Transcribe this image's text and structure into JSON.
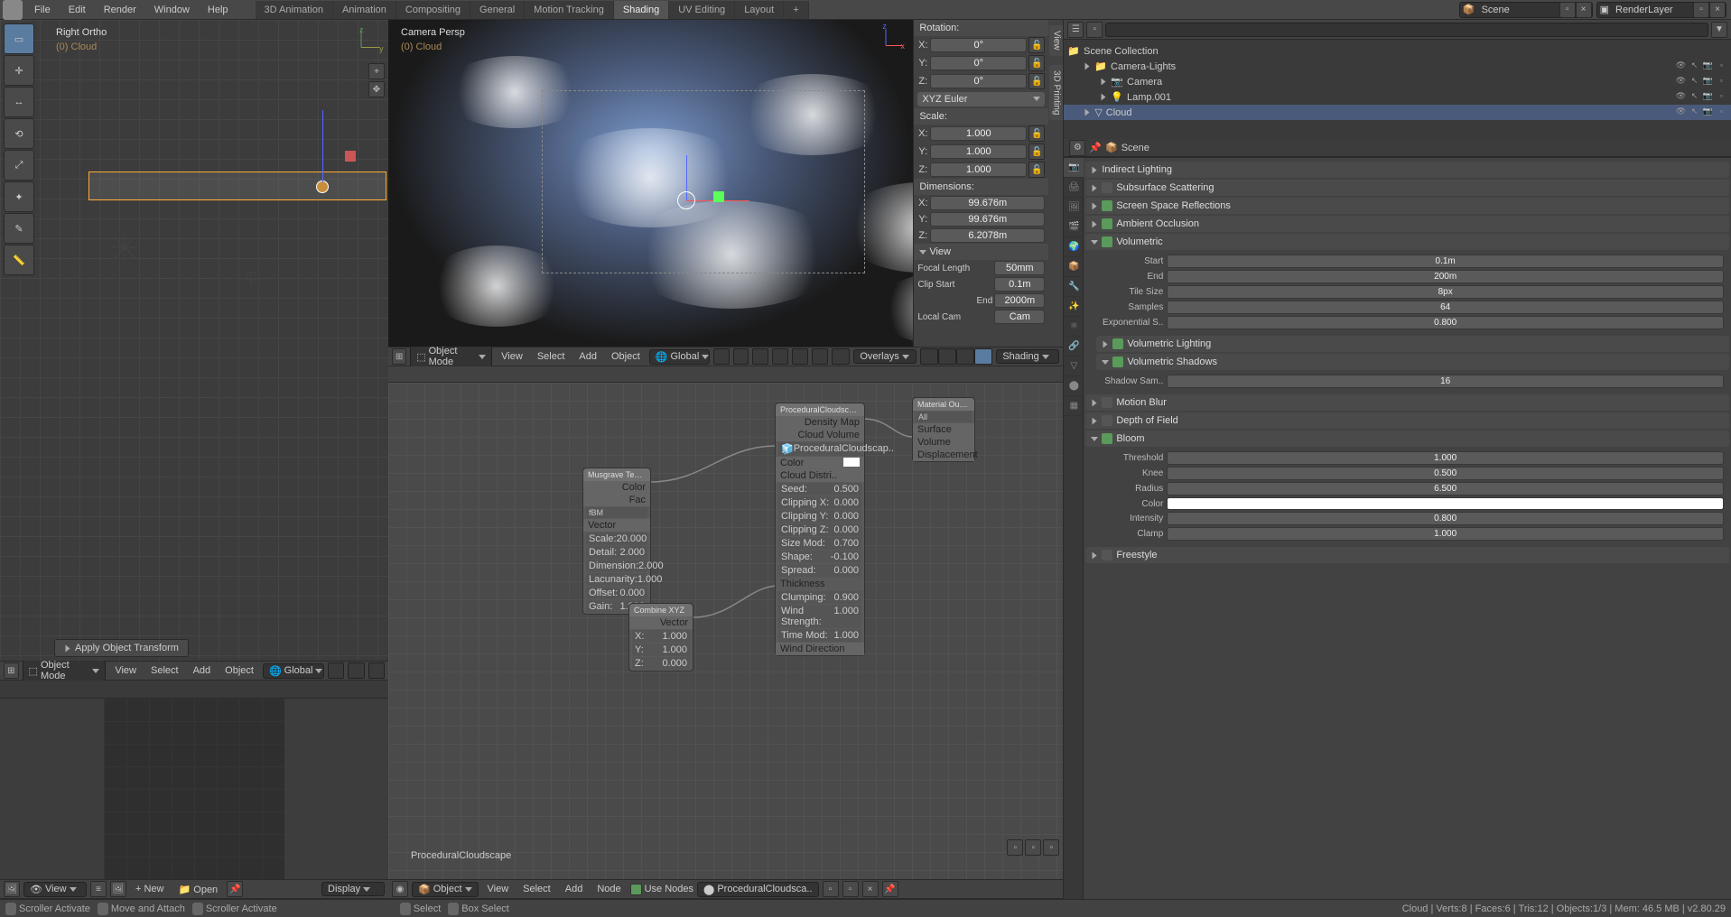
{
  "menus": [
    "File",
    "Edit",
    "Render",
    "Window",
    "Help"
  ],
  "workspaces": [
    "3D Animation",
    "Animation",
    "Compositing",
    "General",
    "Motion Tracking",
    "Shading",
    "UV Editing",
    "Layout"
  ],
  "active_workspace": "Shading",
  "scene_name": "Scene",
  "render_layer": "RenderLayer",
  "viewport_left": {
    "title": "Right Ortho",
    "collection": "(0) Cloud",
    "apply_button": "Apply Object Transform"
  },
  "viewport_cam": {
    "title": "Camera Persp",
    "collection": "(0) Cloud"
  },
  "viewport_menus": [
    "View",
    "Select",
    "Add",
    "Object"
  ],
  "object_mode": "Object Mode",
  "orientation": "Global",
  "overlays_label": "Overlays",
  "shading_label": "Shading",
  "n_panel": {
    "rotation_header": "Rotation:",
    "rot_x": "0°",
    "rot_y": "0°",
    "rot_z": "0°",
    "rot_order": "XYZ Euler",
    "scale_header": "Scale:",
    "scale_x": "1.000",
    "scale_y": "1.000",
    "scale_z": "1.000",
    "dim_header": "Dimensions:",
    "dim_x": "99.676m",
    "dim_y": "99.676m",
    "dim_z": "6.2078m",
    "view_header": "View",
    "focal_label": "Focal Length",
    "focal": "50mm",
    "clip_start_label": "Clip Start",
    "clip_start": "0.1m",
    "clip_end_label": "End",
    "clip_end": "2000m",
    "local_cam_label": "Local Cam",
    "local_cam": "Cam"
  },
  "side_tabs": [
    "View",
    "3D Printing"
  ],
  "outliner": {
    "search_placeholder": "",
    "scene_collection": "Scene Collection",
    "items": [
      {
        "name": "Camera-Lights",
        "type": "collection",
        "indent": 1
      },
      {
        "name": "Camera",
        "type": "camera",
        "indent": 2
      },
      {
        "name": "Lamp.001",
        "type": "light",
        "indent": 2
      },
      {
        "name": "Cloud",
        "type": "mesh",
        "indent": 1,
        "selected": true
      }
    ]
  },
  "breadcrumb": {
    "scene_icon": "S",
    "scene": "Scene"
  },
  "image_editor": {
    "view_menu": "View",
    "new": "New",
    "open": "Open",
    "display": "Display"
  },
  "node_editor": {
    "menus": [
      "View",
      "Select",
      "Add",
      "Node"
    ],
    "object_label": "Object",
    "use_nodes": "Use Nodes",
    "material_name": "ProceduralCloudsca..",
    "mat_label_bottom": "ProceduralCloudscape"
  },
  "nodes": {
    "musgrave": {
      "title": "Musgrave Texture",
      "out_color": "Color",
      "out_fac": "Fac",
      "mode": "fBM",
      "vector": "Vector",
      "params": [
        [
          "Scale:",
          "20.000"
        ],
        [
          "Detail:",
          "2.000"
        ],
        [
          "Dimension:",
          "2.000"
        ],
        [
          "Lacunarity:",
          "1.000"
        ],
        [
          "Offset:",
          "0.000"
        ],
        [
          "Gain:",
          "1.000"
        ]
      ]
    },
    "combine": {
      "title": "Combine XYZ",
      "out": "Vector",
      "params": [
        [
          "X:",
          "1.000"
        ],
        [
          "Y:",
          "1.000"
        ],
        [
          "Z:",
          "0.000"
        ]
      ]
    },
    "cloudscape": {
      "title": "ProceduralCloudscape_v0...",
      "out1": "Density Map",
      "out2": "Cloud Volume",
      "name_field": "ProceduralCloudscap..",
      "color": "Color",
      "distri": "Cloud Distri..",
      "params": [
        [
          "Seed:",
          "0.500"
        ],
        [
          "Clipping X:",
          "0.000"
        ],
        [
          "Clipping Y:",
          "0.000"
        ],
        [
          "Clipping Z:",
          "0.000"
        ],
        [
          "Size Mod:",
          "0.700"
        ],
        [
          "Shape:",
          "-0.100"
        ],
        [
          "Spread:",
          "0.000"
        ]
      ],
      "thickness_header": "Thickness",
      "thickness_params": [
        [
          "Clumping:",
          "0.900"
        ],
        [
          "Wind Strength:",
          "1.000"
        ],
        [
          "Time Mod:",
          "1.000"
        ]
      ],
      "wind_dir": "Wind Direction"
    },
    "output": {
      "title": "Material Output",
      "target": "All",
      "surface": "Surface",
      "volume": "Volume",
      "displacement": "Displacement"
    }
  },
  "panels": [
    {
      "label": "Indirect Lighting",
      "checked": null,
      "expanded": false
    },
    {
      "label": "Subsurface Scattering",
      "checked": false,
      "expanded": false
    },
    {
      "label": "Screen Space Reflections",
      "checked": true,
      "expanded": false
    },
    {
      "label": "Ambient Occlusion",
      "checked": true,
      "expanded": false
    },
    {
      "label": "Volumetric",
      "checked": true,
      "expanded": true,
      "body": [
        [
          "Start",
          "0.1m"
        ],
        [
          "End",
          "200m"
        ],
        [
          "Tile Size",
          "8px"
        ],
        [
          "Samples",
          "64"
        ],
        [
          "Exponential S..",
          "0.800"
        ]
      ],
      "subpanels": [
        {
          "label": "Volumetric Lighting",
          "checked": true
        },
        {
          "label": "Volumetric Shadows",
          "checked": true,
          "body": [
            [
              "Shadow Sam..",
              "16"
            ]
          ]
        }
      ]
    },
    {
      "label": "Motion Blur",
      "checked": false,
      "expanded": false
    },
    {
      "label": "Depth of Field",
      "checked": false,
      "expanded": false
    },
    {
      "label": "Bloom",
      "checked": true,
      "expanded": true,
      "body": [
        [
          "Threshold",
          "1.000"
        ],
        [
          "Knee",
          "0.500"
        ],
        [
          "Radius",
          "6.500"
        ],
        [
          "Color",
          ""
        ],
        [
          "Intensity",
          "0.800"
        ],
        [
          "Clamp",
          "1.000"
        ]
      ]
    },
    {
      "label": "Freestyle",
      "checked": false,
      "expanded": false
    }
  ],
  "status": {
    "left_items": [
      "Scroller Activate",
      "Move and Attach",
      "Scroller Activate"
    ],
    "mid_items": [
      "Select",
      "Box Select"
    ],
    "right": "Cloud | Verts:8 | Faces:6 | Tris:12 | Objects:1/3 | Mem: 46.5 MB | v2.80.29"
  }
}
